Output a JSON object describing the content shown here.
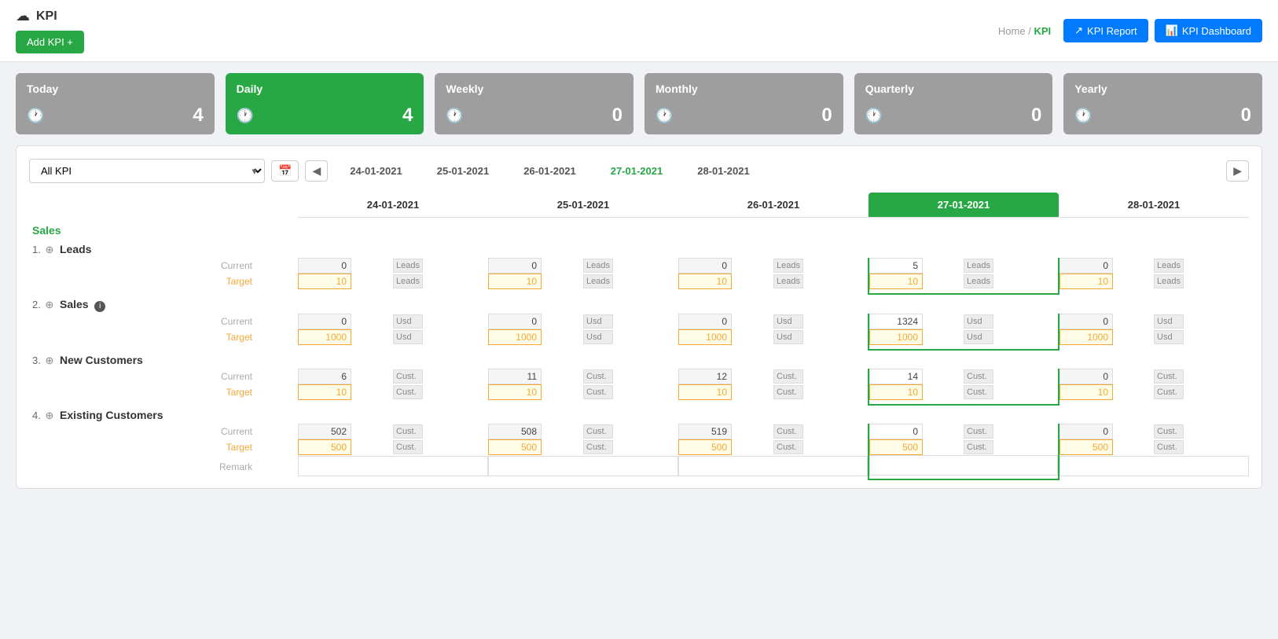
{
  "app": {
    "title": "KPI",
    "logo_icon": "☁",
    "add_btn": "Add KPI +",
    "breadcrumb_home": "Home",
    "breadcrumb_sep": "/",
    "breadcrumb_current": "KPI",
    "btn_report": "KPI Report",
    "btn_dashboard": "KPI Dashboard"
  },
  "period_cards": [
    {
      "label": "Today",
      "value": "4",
      "active": false
    },
    {
      "label": "Daily",
      "value": "4",
      "active": true
    },
    {
      "label": "Weekly",
      "value": "0",
      "active": false
    },
    {
      "label": "Monthly",
      "value": "0",
      "active": false
    },
    {
      "label": "Quarterly",
      "value": "0",
      "active": false
    },
    {
      "label": "Yearly",
      "value": "0",
      "active": false
    }
  ],
  "filter": {
    "kpi_select_value": "All KPI",
    "kpi_select_placeholder": "All KPI"
  },
  "dates": {
    "prev_icon": "◀",
    "next_icon": "▶",
    "calendar_icon": "📅",
    "columns": [
      {
        "date": "24-01-2021",
        "today": false
      },
      {
        "date": "25-01-2021",
        "today": false
      },
      {
        "date": "26-01-2021",
        "today": false
      },
      {
        "date": "27-01-2021",
        "today": true
      },
      {
        "date": "28-01-2021",
        "today": false
      }
    ]
  },
  "sections": [
    {
      "name": "Sales",
      "items": [
        {
          "idx": "1.",
          "globe": "⊕",
          "name": "Leads",
          "info": false,
          "rows": {
            "current": {
              "label": "Current",
              "unit": "Leads",
              "values": [
                "0",
                "0",
                "0",
                "5",
                "0"
              ]
            },
            "target": {
              "label": "Target",
              "unit": "Leads",
              "values": [
                "10",
                "10",
                "10",
                "10",
                "10"
              ]
            }
          }
        },
        {
          "idx": "2.",
          "globe": "⊕",
          "name": "Sales",
          "info": true,
          "rows": {
            "current": {
              "label": "Current",
              "unit": "Usd",
              "values": [
                "0",
                "0",
                "0",
                "1324",
                "0"
              ]
            },
            "target": {
              "label": "Target",
              "unit": "Usd",
              "values": [
                "1000",
                "1000",
                "1000",
                "1000",
                "1000"
              ]
            }
          }
        },
        {
          "idx": "3.",
          "globe": "⊕",
          "name": "New Customers",
          "info": false,
          "rows": {
            "current": {
              "label": "Current",
              "unit": "Cust.",
              "values": [
                "6",
                "11",
                "12",
                "14",
                "0"
              ]
            },
            "target": {
              "label": "Target",
              "unit": "Cust.",
              "values": [
                "10",
                "10",
                "10",
                "10",
                "10"
              ]
            }
          }
        },
        {
          "idx": "4.",
          "globe": "⊕",
          "name": "Existing Customers",
          "info": false,
          "rows": {
            "current": {
              "label": "Current",
              "unit": "Cust.",
              "values": [
                "502",
                "508",
                "519",
                "0",
                "0"
              ]
            },
            "target": {
              "label": "Target",
              "unit": "Cust.",
              "values": [
                "500",
                "500",
                "500",
                "500",
                "500"
              ]
            },
            "has_remark": true
          }
        }
      ]
    }
  ]
}
